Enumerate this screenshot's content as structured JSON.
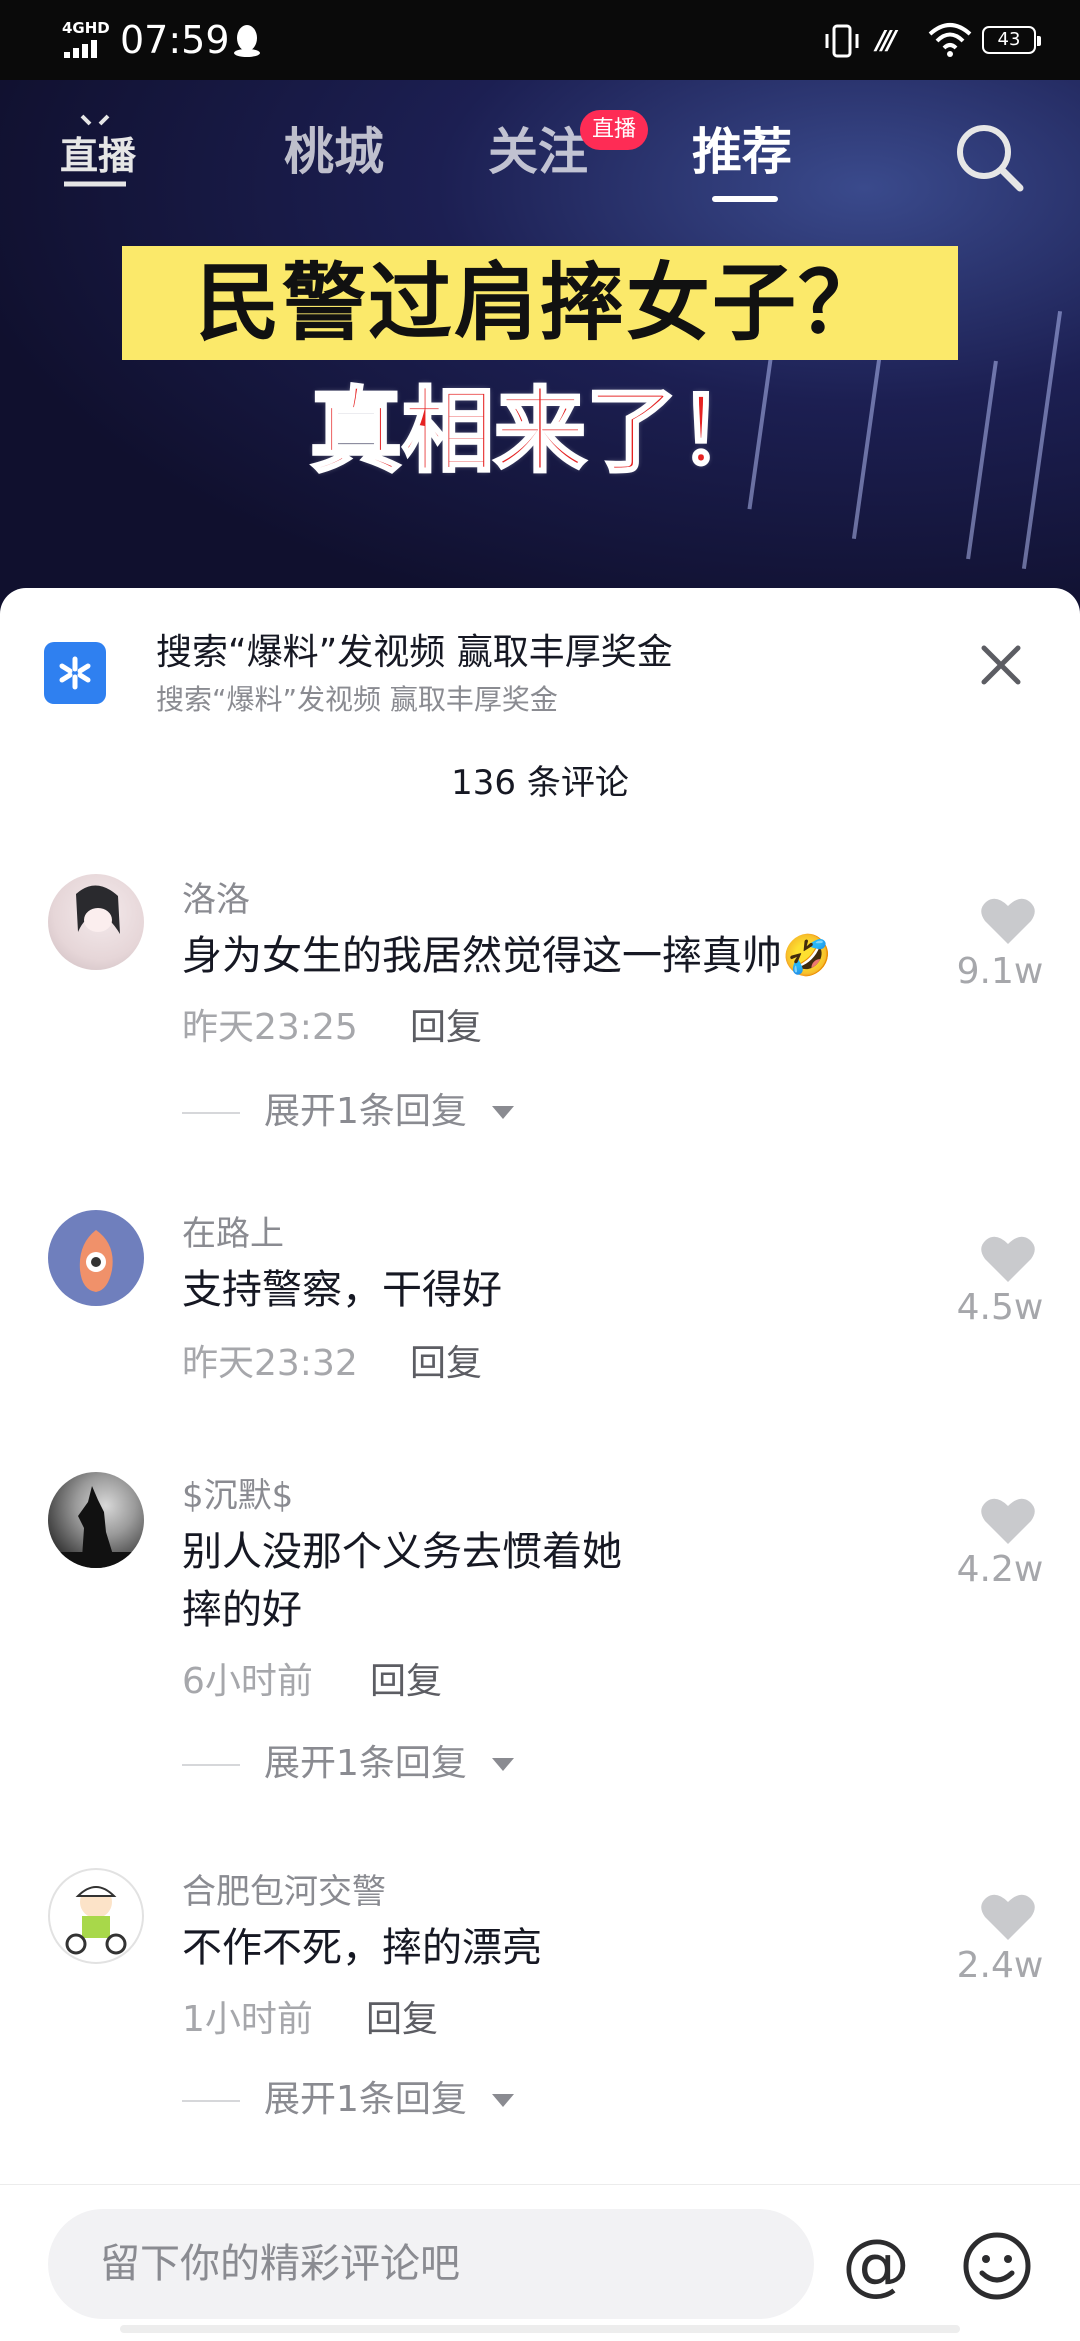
{
  "status_bar": {
    "network": "4GHD",
    "time": "07:59",
    "battery": "43"
  },
  "nav": {
    "tabs": [
      "桃城",
      "关注",
      "推荐"
    ],
    "active_tab": "推荐",
    "live_label": "直播",
    "live_badge": "直播"
  },
  "video": {
    "headline_line1": "民警过肩摔女子？",
    "headline_line2": "真相来了！"
  },
  "sheet": {
    "promo_title": "搜索“爆料”发视频 赢取丰厚奖金",
    "promo_subtitle": "搜索“爆料”发视频 赢取丰厚奖金",
    "comment_count": "136 条评论",
    "reply_label": "回复",
    "comments": [
      {
        "user": "洛洛",
        "text": "身为女生的我居然觉得这一摔真帅🤣",
        "time": "昨天23:25",
        "likes": "9.1w",
        "expand": "展开1条回复"
      },
      {
        "user": "在路上",
        "text": "支持警察，干得好",
        "time": "昨天23:32",
        "likes": "4.5w"
      },
      {
        "user": "$沉默$",
        "text_line1": "别人没那个义务去惯着她",
        "text_line2": "摔的好",
        "time": "6小时前",
        "likes": "4.2w",
        "expand": "展开1条回复"
      },
      {
        "user": "合肥包河交警",
        "text": "不作不死，摔的漂亮",
        "time": "1小时前",
        "likes": "2.4w",
        "expand": "展开1条回复"
      }
    ]
  },
  "input": {
    "placeholder": "留下你的精彩评论吧"
  },
  "icons": {
    "at": "@",
    "emoji": "smiley-icon",
    "like": "heart-icon"
  },
  "colors": {
    "accent": "#fe2c55",
    "promo_icon": "#2f80f0",
    "headline_bg": "#fbe96a",
    "headline_red": "#e52222"
  }
}
